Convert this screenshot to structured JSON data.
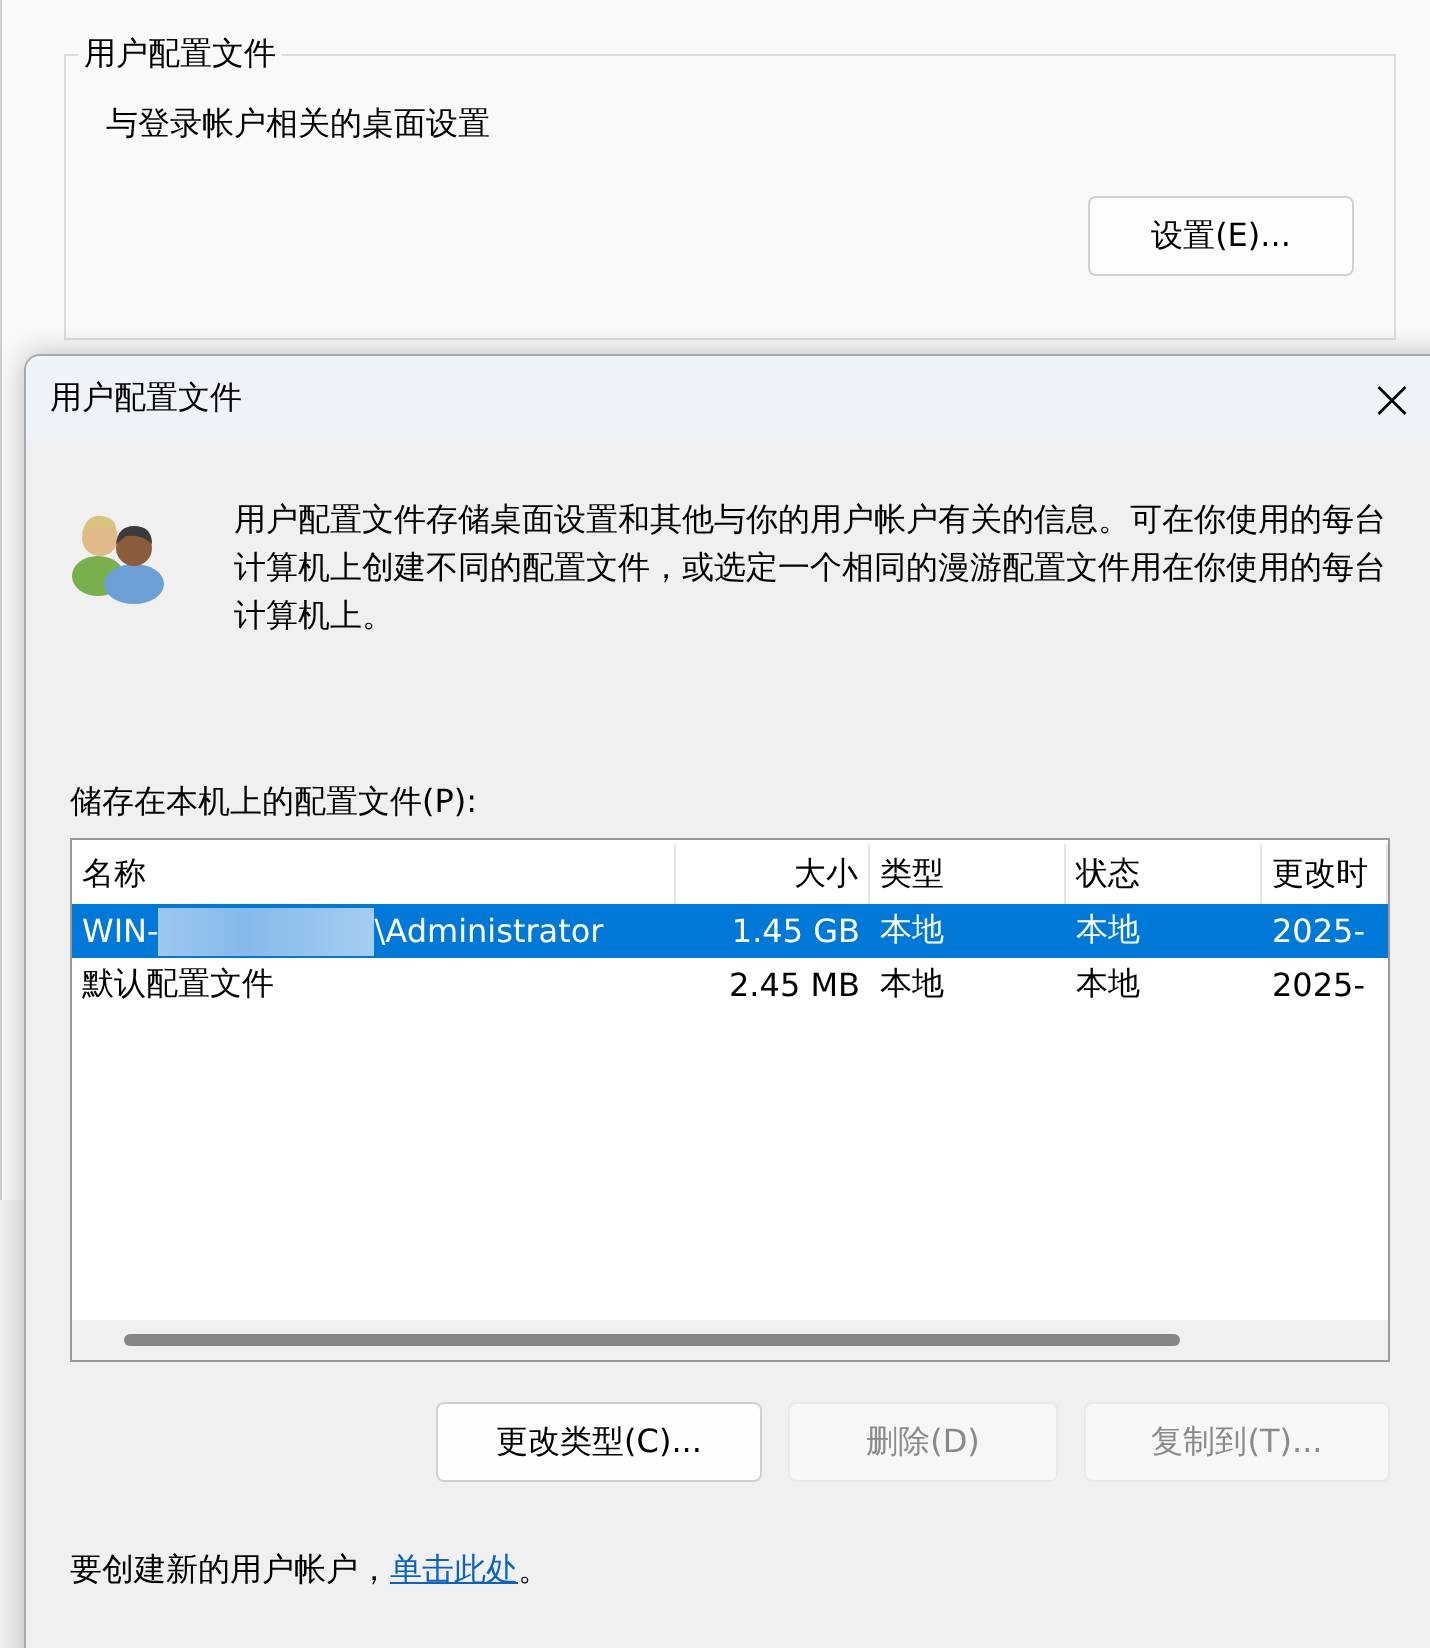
{
  "back_window": {
    "group_title": "用户配置文件",
    "description": "与登录帐户相关的桌面设置",
    "settings_button": "设置(E)..."
  },
  "dialog": {
    "title": "用户配置文件",
    "close": "×",
    "info": "用户配置文件存储桌面设置和其他与你的用户帐户有关的信息。可在你使用的每台计算机上创建不同的配置文件，或选定一个相同的漫游配置文件用在你使用的每台计算机上。",
    "list_label": "储存在本机上的配置文件(P):",
    "table": {
      "columns": [
        "名称",
        "大小",
        "类型",
        "状态",
        "更改时"
      ],
      "rows": [
        {
          "selected": true,
          "redacted": true,
          "name_prefix": "WIN-",
          "name": "\\Administrator",
          "size": "1.45 GB",
          "type": "本地",
          "status": "本地",
          "modified": "2025-"
        },
        {
          "selected": false,
          "redacted": false,
          "name_prefix": "",
          "name": "默认配置文件",
          "size": "2.45 MB",
          "type": "本地",
          "status": "本地",
          "modified": "2025-"
        }
      ]
    },
    "buttons": [
      {
        "label": "更改类型(C)...",
        "disabled": false
      },
      {
        "label": "删除(D)",
        "disabled": true
      },
      {
        "label": "复制到(T)...",
        "disabled": true
      }
    ],
    "footer_text": "要创建新的用户帐户，",
    "footer_link": "单击此处",
    "footer_end": "。"
  }
}
